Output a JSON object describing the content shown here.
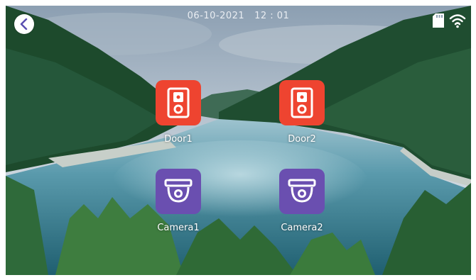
{
  "status": {
    "datetime": "06-10-2021   12 : 01",
    "icons": [
      "back-icon",
      "sd-card-icon",
      "wifi-icon"
    ]
  },
  "tiles": [
    {
      "label": "Door1",
      "icon": "doorbell-icon",
      "color": "#ee4430"
    },
    {
      "label": "Door2",
      "icon": "doorbell-icon",
      "color": "#ee4430"
    },
    {
      "label": "Camera1",
      "icon": "dome-camera-icon",
      "color": "#6a4fb0"
    },
    {
      "label": "Camera2",
      "icon": "dome-camera-icon",
      "color": "#6a4fb0"
    }
  ],
  "colors": {
    "door_tile": "#ee4430",
    "camera_tile": "#6a4fb0",
    "text": "#ffffff"
  }
}
